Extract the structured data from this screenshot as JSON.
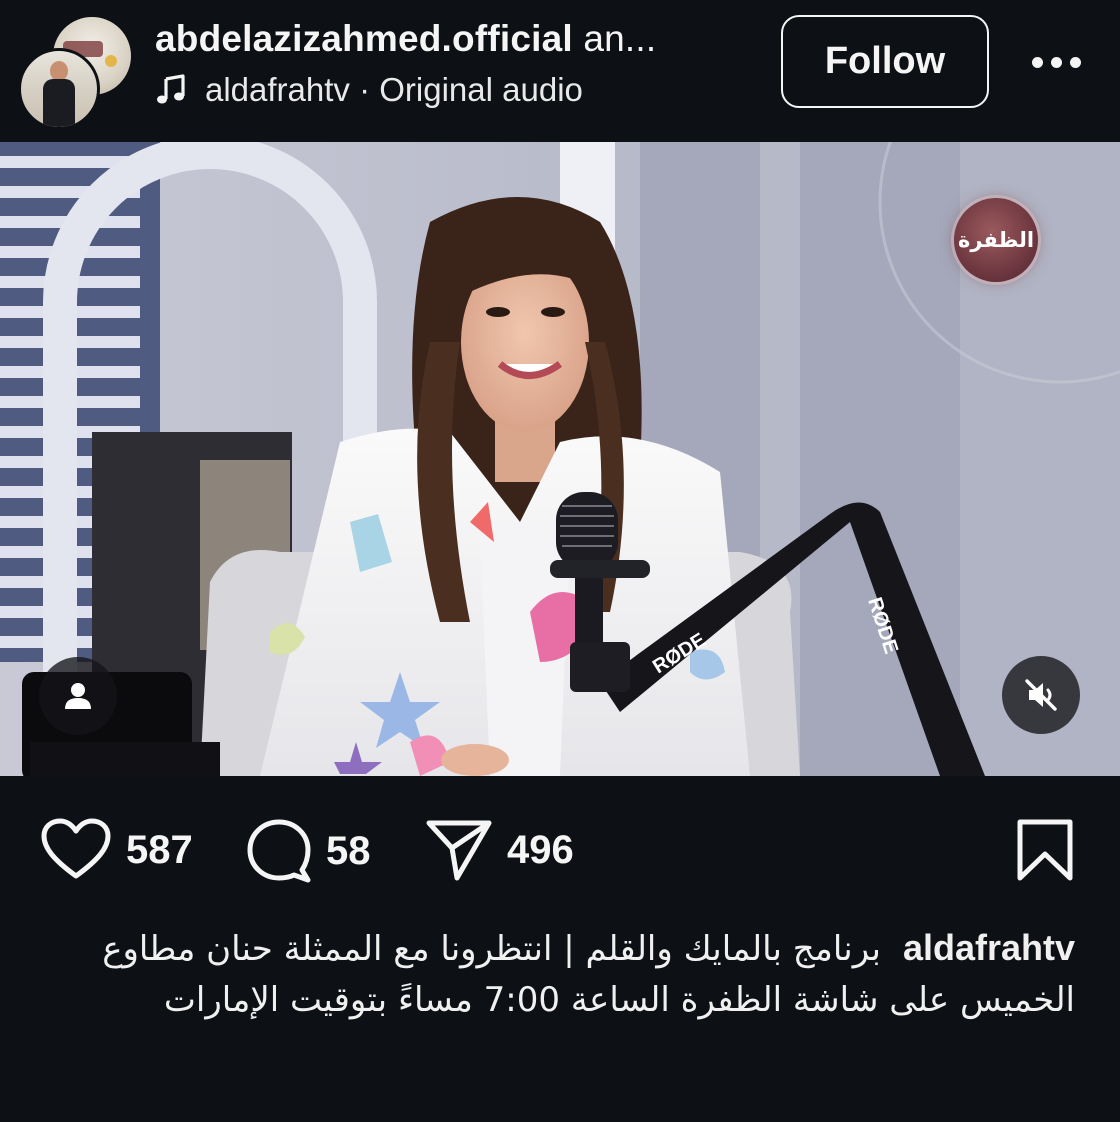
{
  "header": {
    "username": "abdelazizahmed.official",
    "username_suffix": "an...",
    "audio_label": "aldafrahtv · Original audio",
    "follow_label": "Follow"
  },
  "media": {
    "channel_logo_text": "الظفرة",
    "mic_brand": "RØDE",
    "muted": true
  },
  "actions": {
    "likes": "587",
    "comments": "58",
    "shares": "496"
  },
  "caption": {
    "username": "aldafrahtv",
    "text": "برنامج بالمايك والقلم | انتظرونا مع الممثلة حنان مطاوع الخميس على شاشة الظفرة الساعة 7:00 مساءً بتوقيت الإمارات"
  },
  "colors": {
    "background": "#0d1014",
    "text": "#f5f5f5"
  },
  "icons": [
    "music-note-icon",
    "more-options-icon",
    "user-tag-icon",
    "mute-icon",
    "heart-icon",
    "comment-icon",
    "share-icon",
    "bookmark-icon"
  ]
}
